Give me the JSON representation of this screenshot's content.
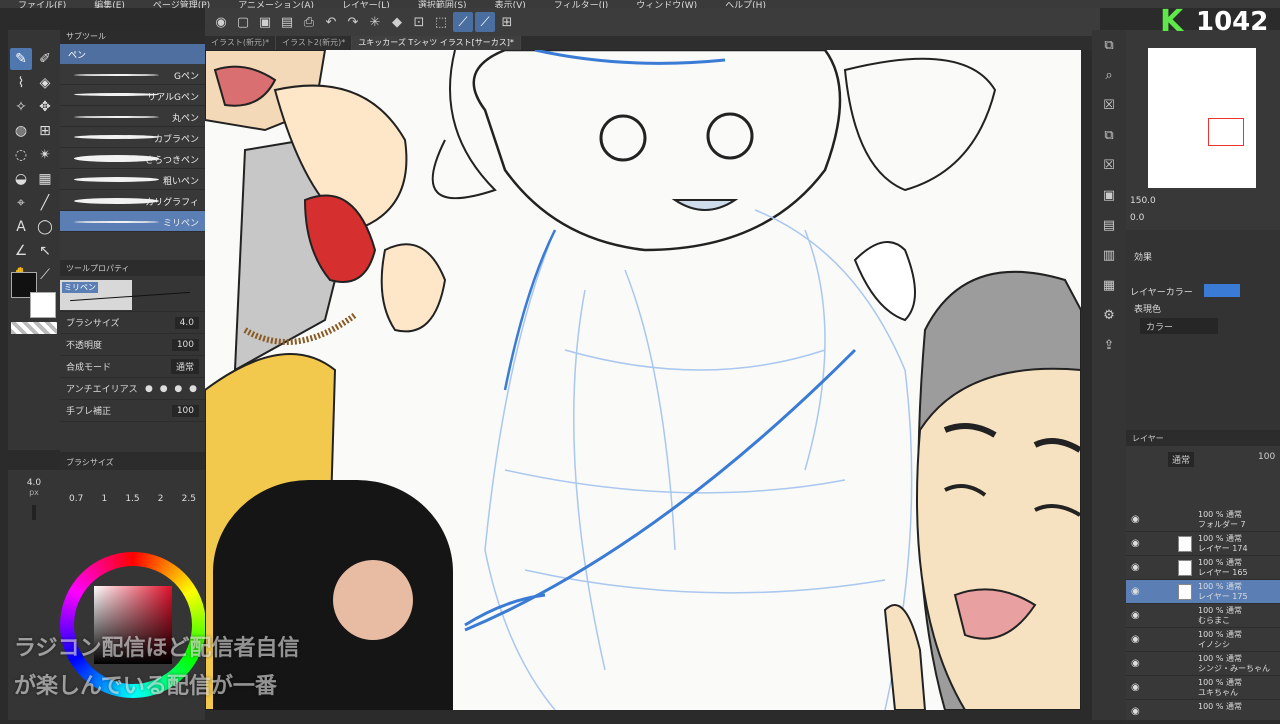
{
  "menubar": {
    "items": [
      "ファイル(F)",
      "編集(E)",
      "ページ管理(P)",
      "アニメーション(A)",
      "レイヤー(L)",
      "選択範囲(S)",
      "表示(V)",
      "フィルター(I)",
      "ウィンドウ(W)",
      "ヘルプ(H)"
    ]
  },
  "tabs": [
    {
      "label": "イラスト(新元)*"
    },
    {
      "label": "イラスト2(新元)*"
    },
    {
      "label": "ユキッカーズ Tシャツ イラスト[サーカス]*"
    }
  ],
  "subtool": {
    "title": "サブツール",
    "group": "ペン",
    "brushes": [
      "Gペン",
      "リアルGペン",
      "丸ペン",
      "カブラペン",
      "さらつきペン",
      "粗いペン",
      "カリグラフィ",
      "ミリペン"
    ]
  },
  "toolprop": {
    "title": "ツールプロパティ",
    "brush_name": "ミリペン",
    "rows": [
      {
        "label": "ブラシサイズ",
        "value": "4.0"
      },
      {
        "label": "不透明度",
        "value": "100"
      },
      {
        "label": "合成モード",
        "value": "通常"
      },
      {
        "label": "アンチエイリアス",
        "value": ""
      },
      {
        "label": "手ブレ補正",
        "value": "100"
      }
    ]
  },
  "brushsize": {
    "title": "ブラシサイズ",
    "current": "4.0",
    "unit": "px",
    "opacity": "100",
    "opacity_unit": "%",
    "presets": [
      "0.7",
      "1",
      "1.5",
      "2",
      "2.5"
    ]
  },
  "navigator": {
    "zoom": "150.0",
    "angle": "0.0"
  },
  "layerprop": {
    "effect_label": "効果",
    "layer_color_label": "レイヤーカラー",
    "expression_label": "表現色",
    "expression_value": "カラー"
  },
  "layers": {
    "title": "レイヤー",
    "blend": "通常",
    "opacity": "100",
    "rows": [
      {
        "line1": "100 % 通常",
        "line2": "フォルダー 7"
      },
      {
        "line1": "100 % 通常",
        "line2": "レイヤー 174"
      },
      {
        "line1": "100 % 通常",
        "line2": "レイヤー 165"
      },
      {
        "line1": "100 % 通常",
        "line2": "レイヤー 175"
      },
      {
        "line1": "100 % 通常",
        "line2": "むらまこ"
      },
      {
        "line1": "100 % 通常",
        "line2": "イノシシ"
      },
      {
        "line1": "100 % 通常",
        "line2": "シンジ・みーちゃん"
      },
      {
        "line1": "100 % 通常",
        "line2": "ユキちゃん"
      },
      {
        "line1": "100 % 通常",
        "line2": ""
      }
    ]
  },
  "badge": {
    "letter": "K",
    "number": "1042"
  },
  "overlay": {
    "line1": "ラジコン配信ほど配信者自信",
    "line2": "が楽しんでいる配信が一番"
  },
  "colors": {
    "accent": "#4f77b0",
    "badge_green": "#5ee84a",
    "main_color": "#111111",
    "sub_color": "#ffffff"
  }
}
